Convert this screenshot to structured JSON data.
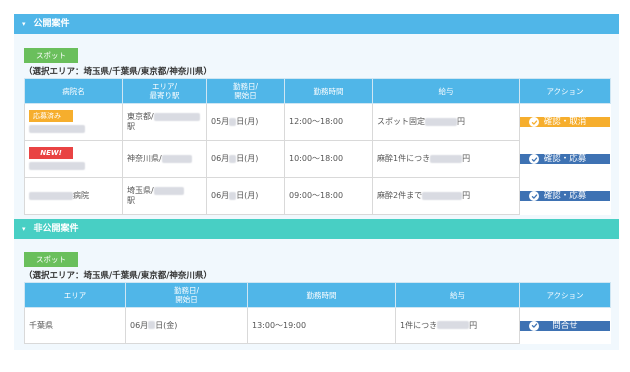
{
  "public_section": {
    "title": "公開案件",
    "spot_badge": "スポット",
    "area_text": "（選択エリア：埼玉県/千葉県/東京都/神奈川県）",
    "headers": [
      "病院名",
      "エリア/\n最寄り駅",
      "勤務日/\n開始日",
      "勤務時間",
      "給与",
      "アクション"
    ],
    "rows": [
      {
        "badge": "応募済み",
        "badge_type": "applied",
        "hospital": "",
        "area_a": "東京都/",
        "area_b": "駅",
        "date_pre": "05月",
        "date_post": "日(月)",
        "time": "12:00～18:00",
        "salary_pre": "スポット固定",
        "salary_post": "円",
        "action": "確認・取消",
        "action_color": "orange"
      },
      {
        "badge": "NEW!",
        "badge_type": "new",
        "hospital": "",
        "area_a": "神奈川県/",
        "area_b": "",
        "date_pre": "06月",
        "date_post": "日(月)",
        "time": "10:00～18:00",
        "salary_pre": "麻酔1件につき",
        "salary_post": "円",
        "action": "確認・応募",
        "action_color": "blue"
      },
      {
        "badge": "",
        "badge_type": "",
        "hospital": "病院",
        "area_a": "埼玉県/",
        "area_b": "駅",
        "date_pre": "06月",
        "date_post": "日(月)",
        "time": "09:00～18:00",
        "salary_pre": "麻酔2件まで",
        "salary_post": "円",
        "action": "確認・応募",
        "action_color": "blue"
      }
    ]
  },
  "private_section": {
    "title": "非公開案件",
    "spot_badge": "スポット",
    "area_text": "（選択エリア：埼玉県/千葉県/東京都/神奈川県）",
    "headers": [
      "エリア",
      "勤務日/\n開始日",
      "勤務時間",
      "給与",
      "アクション"
    ],
    "rows": [
      {
        "area": "千葉県",
        "date_pre": "06月",
        "date_post": "日(金)",
        "time": "13:00～19:00",
        "salary_pre": "1件につき",
        "salary_post": "円",
        "action": "問合せ",
        "action_color": "blue"
      }
    ]
  },
  "colors": {
    "public_header": "#50b6e8",
    "private_header": "#48cfc4",
    "spot_badge": "#6abf5c",
    "button_orange": "#f6ae2d",
    "button_blue": "#3e72b3",
    "badge_new": "#e94343"
  },
  "icons": {
    "collapse": "chevron-down-icon",
    "action": "check-circle-icon"
  }
}
